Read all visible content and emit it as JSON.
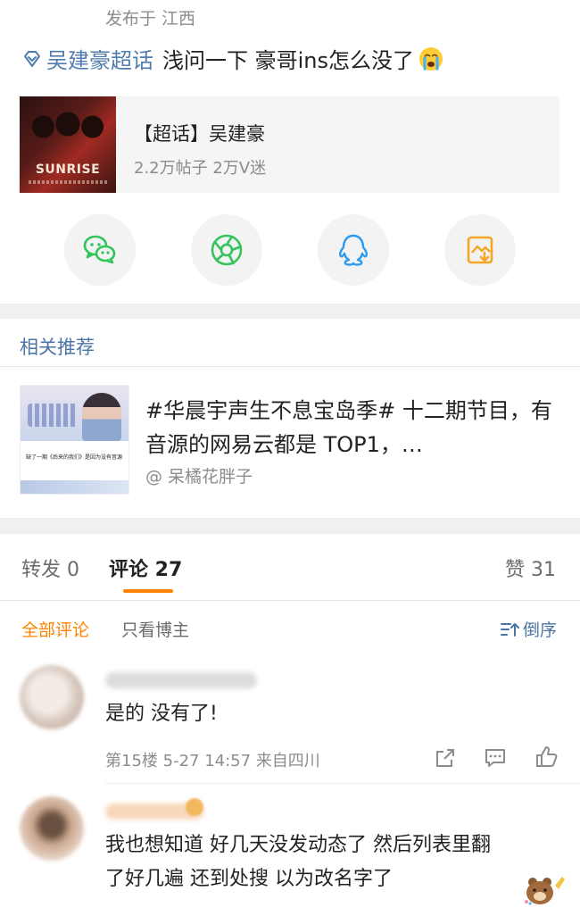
{
  "post": {
    "location_meta": "发布于 江西",
    "chaohua_link": "吴建豪超话",
    "content": "浅问一下 豪哥ins怎么没了",
    "emoji": "crying-face"
  },
  "topic_card": {
    "title": "【超话】吴建豪",
    "stats": "2.2万帖子 2万V迷",
    "image_text": "SUNRISE"
  },
  "share": {
    "items": [
      {
        "icon": "wechat-icon",
        "color": "#33c45a"
      },
      {
        "icon": "moments-icon",
        "color": "#33c45a"
      },
      {
        "icon": "qq-icon",
        "color": "#2a9bf0"
      },
      {
        "icon": "save-image-icon",
        "color": "#f5a623"
      }
    ]
  },
  "related": {
    "header": "相关推荐",
    "title": "#华晨宇声生不息宝岛季# 十二期节目，有音源的网易云都是 TOP1，…",
    "author": "@ 呆橘花胖子",
    "thumb_caption": "缺了一期《后来的我们》是因为没有音源"
  },
  "tabs": {
    "repost": "转发 0",
    "comments": "评论 27",
    "likes": "赞 31"
  },
  "filters": {
    "all": "全部评论",
    "author_only": "只看博主",
    "sort": "倒序"
  },
  "comments": [
    {
      "text": "是的 没有了!",
      "meta": "第15楼 5-27 14:57 来自四川"
    },
    {
      "line1": "我也想知道 好几天没发动态了 然后列表里翻",
      "line2": "了好几遍 还到处搜 以为改名字了"
    }
  ],
  "colors": {
    "accent": "#ff8200",
    "link": "#507daf",
    "gray_text": "#8c8c8c"
  }
}
